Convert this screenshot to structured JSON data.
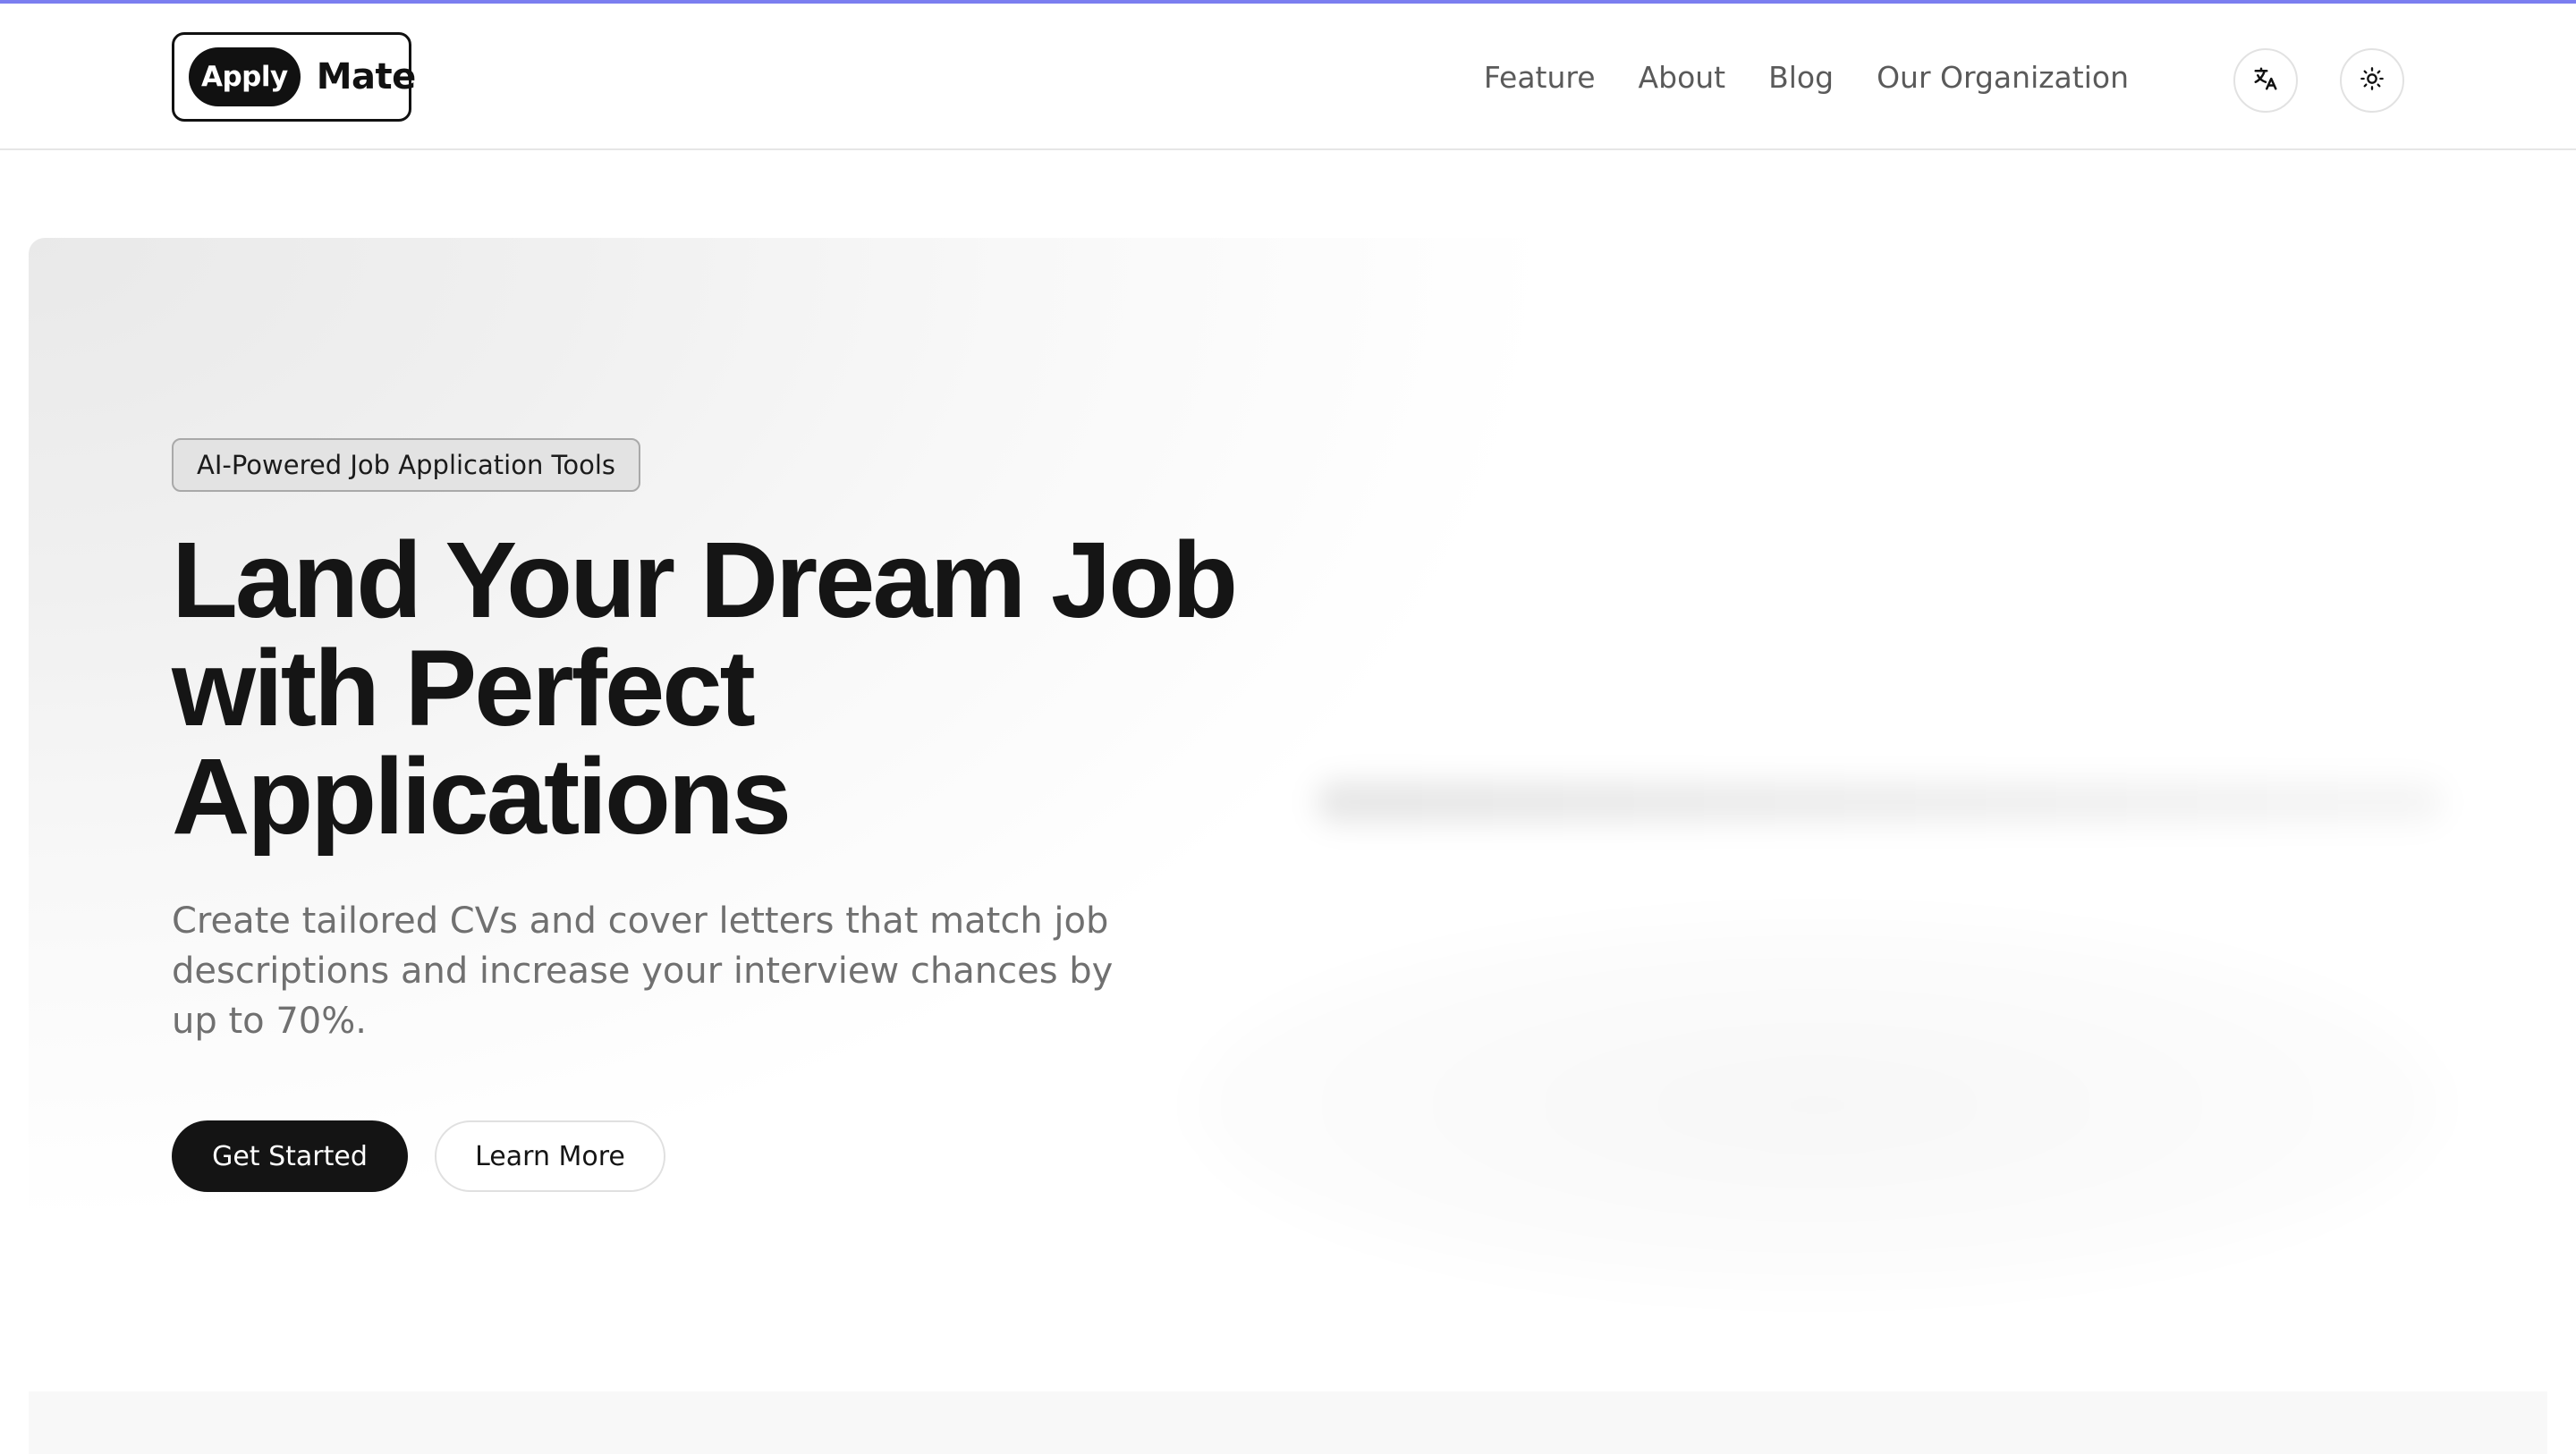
{
  "header": {
    "logo": {
      "pill": "Apply",
      "word": "Mate"
    },
    "nav": [
      {
        "label": "Feature"
      },
      {
        "label": "About"
      },
      {
        "label": "Blog"
      },
      {
        "label": "Our Organization"
      }
    ],
    "icons": {
      "translate": "translate-icon",
      "theme": "sun-icon"
    }
  },
  "hero": {
    "badge": "AI-Powered Job Application Tools",
    "headline": "Land Your Dream Job with Perfect Applications",
    "subtitle": "Create tailored CVs and cover letters that match job descriptions and increase your interview chances by up to 70%.",
    "primary_button": "Get Started",
    "secondary_button": "Learn More"
  },
  "colors": {
    "accent_strip": "#7b7ef0",
    "primary": "#141414"
  }
}
